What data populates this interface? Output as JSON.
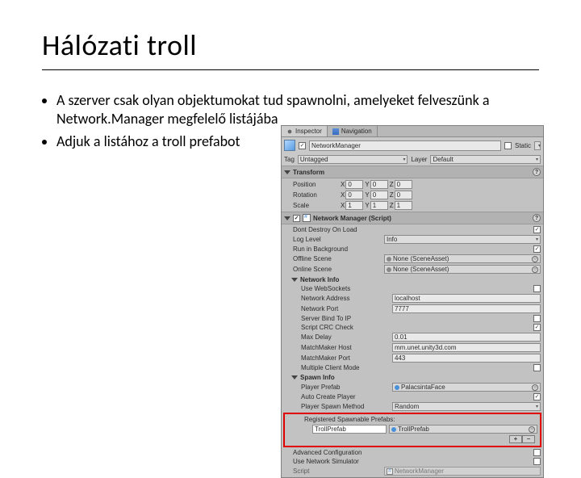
{
  "slide": {
    "title": "Hálózati troll",
    "bullets": [
      "A szerver csak olyan objektumokat tud spawnolni, amelyeket felveszünk a Network.Manager megfelelő listájába",
      "Adjuk a listához a troll prefabot"
    ]
  },
  "inspector": {
    "tabs": {
      "inspector": "Inspector",
      "navigation": "Navigation"
    },
    "header": {
      "name": "NetworkManager",
      "static_label": "Static",
      "tag_label": "Tag",
      "tag_value": "Untagged",
      "layer_label": "Layer",
      "layer_value": "Default"
    },
    "transform": {
      "title": "Transform",
      "position": {
        "label": "Position",
        "x": "0",
        "y": "0",
        "z": "0"
      },
      "rotation": {
        "label": "Rotation",
        "x": "0",
        "y": "0",
        "z": "0"
      },
      "scale": {
        "label": "Scale",
        "x": "1",
        "y": "1",
        "z": "1"
      }
    },
    "nm": {
      "title": "Network Manager (Script)",
      "rows": {
        "dont_destroy": "Dont Destroy On Load",
        "log_level_label": "Log Level",
        "log_level_value": "Info",
        "run_bg": "Run in Background",
        "offline_label": "Offline Scene",
        "offline_value": "None (SceneAsset)",
        "online_label": "Online Scene",
        "online_value": "None (SceneAsset)"
      },
      "network_info": {
        "title": "Network Info",
        "use_ws": "Use WebSockets",
        "addr_label": "Network Address",
        "addr_value": "localhost",
        "port_label": "Network Port",
        "port_value": "7777",
        "bind_ip": "Server Bind To IP",
        "crc": "Script CRC Check",
        "maxdelay_label": "Max Delay",
        "maxdelay_value": "0.01",
        "mmhost_label": "MatchMaker Host",
        "mmhost_value": "mm.unet.unity3d.com",
        "mmport_label": "MatchMaker Port",
        "mmport_value": "443",
        "multiclient": "Multiple Client Mode"
      },
      "spawn_info": {
        "title": "Spawn Info",
        "prefab_label": "Player Prefab",
        "prefab_value": "PalacsintaFace",
        "auto_create": "Auto Create Player",
        "spawn_method_label": "Player Spawn Method",
        "spawn_method_value": "Random",
        "reg_prefabs": "Registered Spawnable Prefabs:",
        "reg_item_value": "TrollPrefab",
        "plus": "+",
        "minus": "−"
      },
      "tail": {
        "adv": "Advanced Configuration",
        "use_sim": "Use Network Simulator",
        "script_label": "Script",
        "script_value": "NetworkManager"
      }
    }
  }
}
